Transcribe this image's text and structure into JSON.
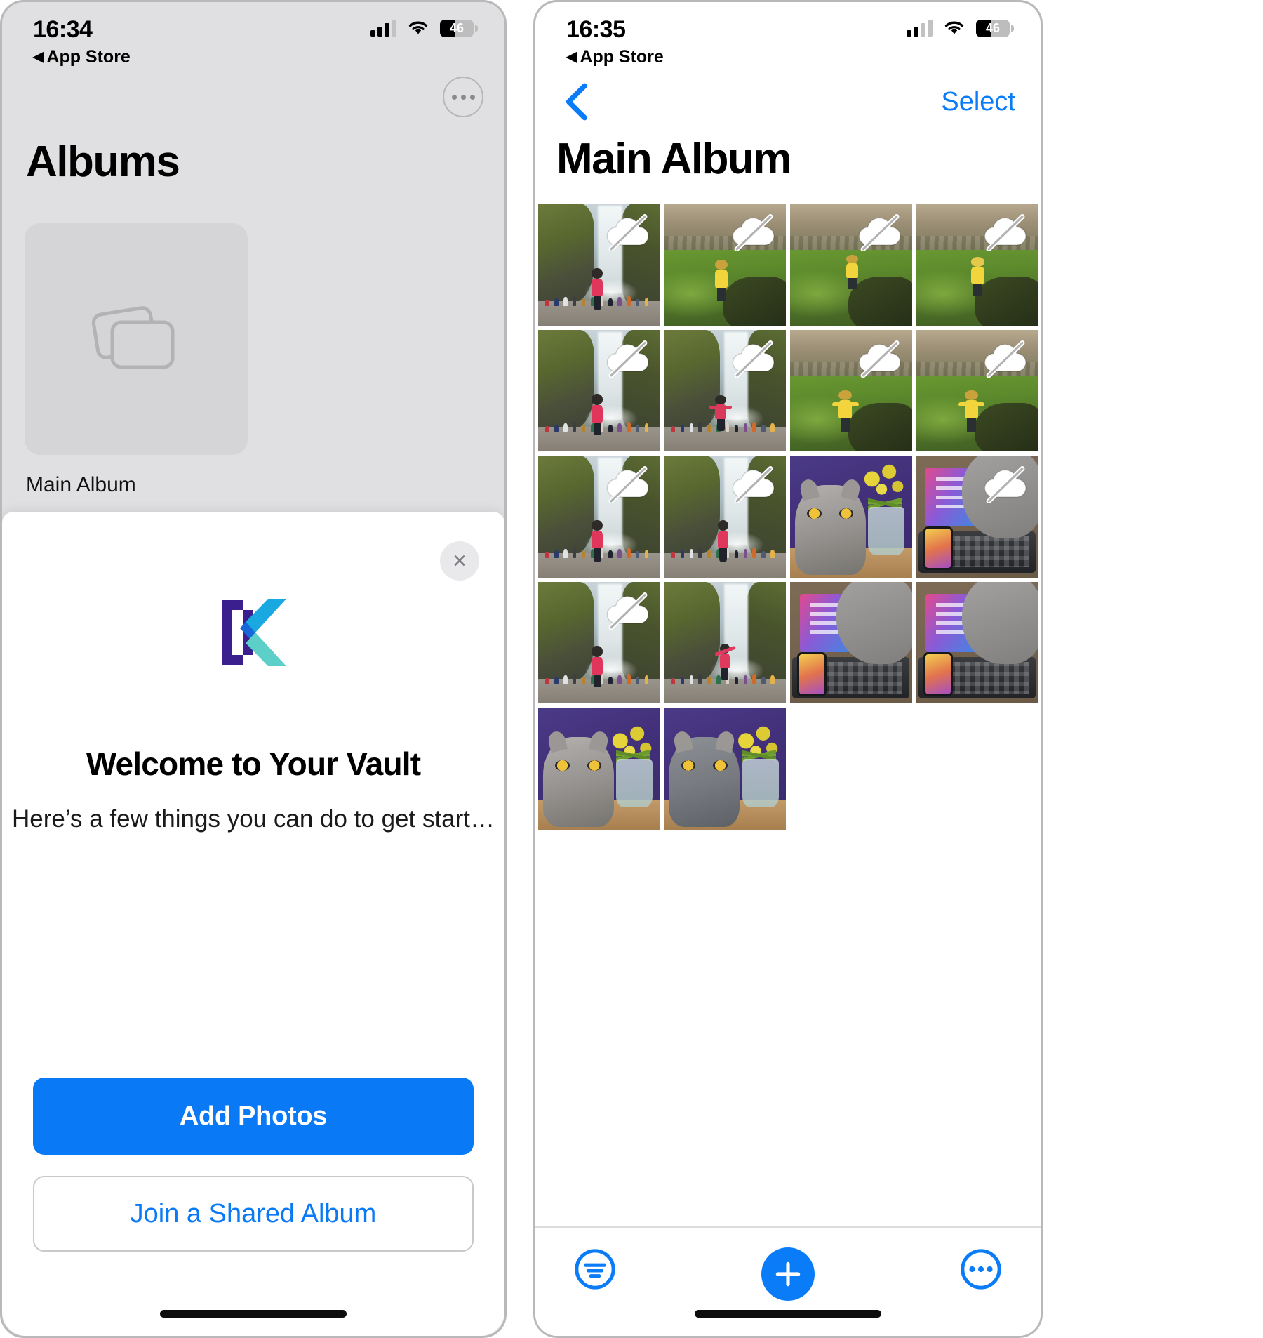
{
  "left_phone": {
    "status": {
      "time": "16:34",
      "back_label": "App Store",
      "battery_percent": "46",
      "signal_bars_filled": 3,
      "signal_bars_total": 4
    },
    "more_button": "more-options",
    "title": "Albums",
    "album": {
      "name": "Main Album",
      "thumb_icon": "albums-stack-icon"
    },
    "sheet": {
      "close_label": "×",
      "logo": "keepsafe-k-logo",
      "heading": "Welcome to Your Vault",
      "subtitle": "Here’s a few things you can do to get start…",
      "primary_button": "Add Photos",
      "secondary_button": "Join a Shared Album"
    }
  },
  "right_phone": {
    "status": {
      "time": "16:35",
      "back_label": "App Store",
      "battery_percent": "46",
      "signal_bars_filled": 2,
      "signal_bars_total": 4
    },
    "nav": {
      "back_icon": "chevron-left-icon",
      "select_label": "Select"
    },
    "title": "Main Album",
    "grid": {
      "badge_icon": "cloud-slash-icon",
      "photos": [
        {
          "scene": "waterfall",
          "badge": true,
          "variant": "pink-walker"
        },
        {
          "scene": "hill",
          "badge": true,
          "variant": "yellow-standing"
        },
        {
          "scene": "hill",
          "badge": true,
          "variant": "yellow-rock"
        },
        {
          "scene": "hill",
          "badge": true,
          "variant": "yellow-hood"
        },
        {
          "scene": "waterfall",
          "badge": true,
          "variant": "pink-walker"
        },
        {
          "scene": "waterfall",
          "badge": true,
          "variant": "pink-arms"
        },
        {
          "scene": "hill",
          "badge": true,
          "variant": "yellow-arms"
        },
        {
          "scene": "hill",
          "badge": true,
          "variant": "yellow-arms"
        },
        {
          "scene": "waterfall",
          "badge": true,
          "variant": "pink-walker"
        },
        {
          "scene": "waterfall",
          "badge": true,
          "variant": "pink-walker"
        },
        {
          "scene": "cat",
          "badge": false,
          "variant": "cat-front"
        },
        {
          "scene": "desk",
          "badge": true,
          "variant": "paw-laptop"
        },
        {
          "scene": "waterfall",
          "badge": true,
          "variant": "pink-walker"
        },
        {
          "scene": "waterfall",
          "badge": false,
          "variant": "pink-arms-up"
        },
        {
          "scene": "desk",
          "badge": false,
          "variant": "paw-laptop"
        },
        {
          "scene": "desk",
          "badge": false,
          "variant": "paw-laptop"
        },
        {
          "scene": "cat",
          "badge": false,
          "variant": "cat-grey"
        },
        {
          "scene": "cat",
          "badge": false,
          "variant": "cat-yellow"
        }
      ]
    },
    "toolbar": {
      "filter_icon": "filter-sort-icon",
      "add_label": "add-photo",
      "add_icon": "plus-icon",
      "more_icon": "more-circle-icon"
    }
  },
  "colors": {
    "accent": "#0a7cf7",
    "primary_button": "#0a79f5",
    "sheet_bg": "#ffffff",
    "left_bg": "#e0e0e2"
  }
}
